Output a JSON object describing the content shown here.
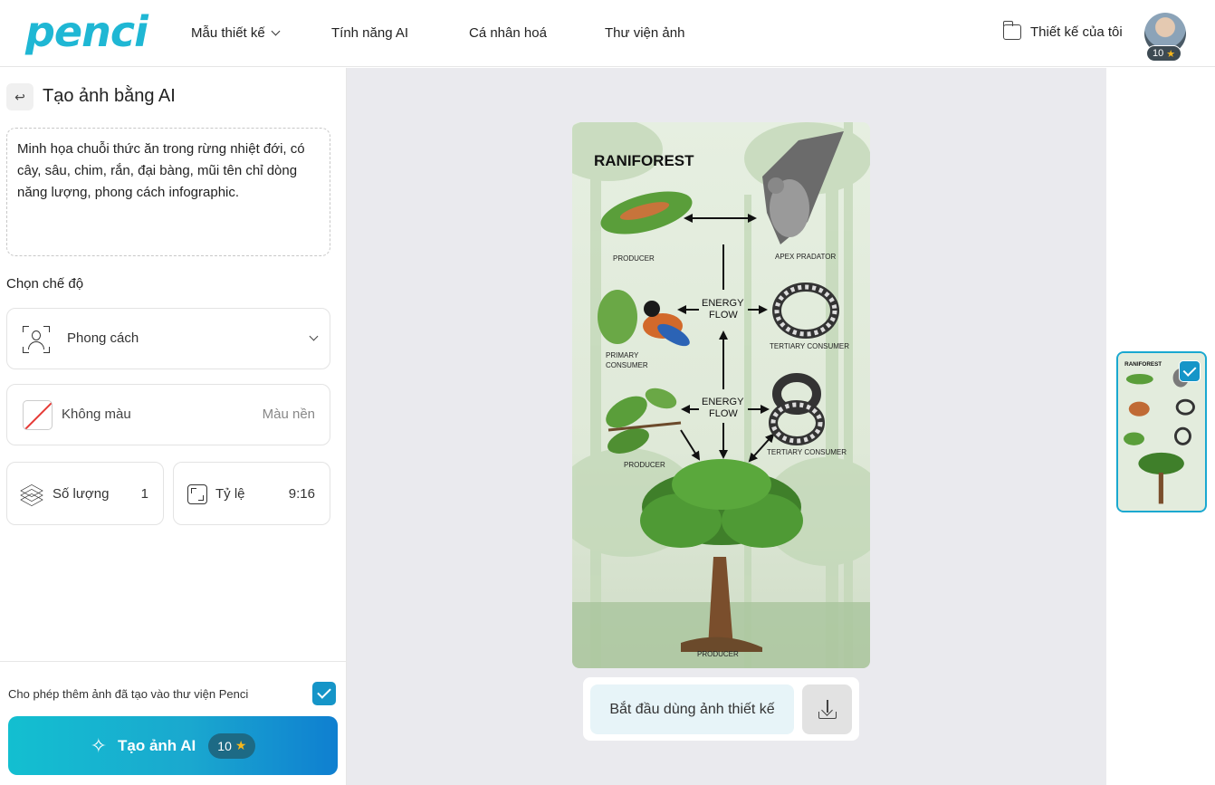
{
  "brand": {
    "logo_text": "penci",
    "accent_color": "#1fb7d4"
  },
  "nav": {
    "items": [
      {
        "label": "Mẫu thiết kế",
        "has_dropdown": true
      },
      {
        "label": "Tính năng AI"
      },
      {
        "label": "Cá nhân hoá"
      },
      {
        "label": "Thư viện ảnh"
      }
    ],
    "my_designs": "Thiết kế của tôi",
    "credits": "10"
  },
  "left_panel": {
    "title": "Tạo ảnh bằng AI",
    "prompt": "Minh họa chuỗi thức ăn trong rừng nhiệt đới, có cây, sâu, chim, rắn, đại bàng, mũi tên chỉ dòng năng lượng, phong cách infographic.",
    "mode_label": "Chọn chế độ",
    "style": {
      "label": "Phong cách"
    },
    "color": {
      "label": "Không màu",
      "right_label": "Màu nền"
    },
    "quantity": {
      "label": "Số lượng",
      "value": "1"
    },
    "ratio": {
      "label": "Tỷ lệ",
      "value": "9:16"
    },
    "allow_library": {
      "label": "Cho phép thêm ảnh đã tạo vào thư viện Penci",
      "checked": true
    },
    "create_button": {
      "label": "Tạo ảnh AI",
      "cost": "10"
    }
  },
  "poster": {
    "title": "RANIFOREST",
    "labels": {
      "producer_top": "PRODUCER",
      "apex": "APEX PRADATOR",
      "energy_flow_1a": "ENERGY",
      "energy_flow_1b": "FLOW",
      "primary_a": "PRIMARY",
      "primary_b": "CONSUMER",
      "tertiary_1": "TERTIARY CONSUMER",
      "energy_flow_2a": "ENERGY",
      "energy_flow_2b": "FLOW",
      "producer_mid": "PRODUCER",
      "tertiary_2": "TERTIARY CONSUMER",
      "producer_bottom": "PRODUCER"
    }
  },
  "actions": {
    "start_label": "Bắt đầu dùng ảnh thiết kế"
  },
  "thumbnail": {
    "title": "RANIFOREST",
    "selected": true
  }
}
